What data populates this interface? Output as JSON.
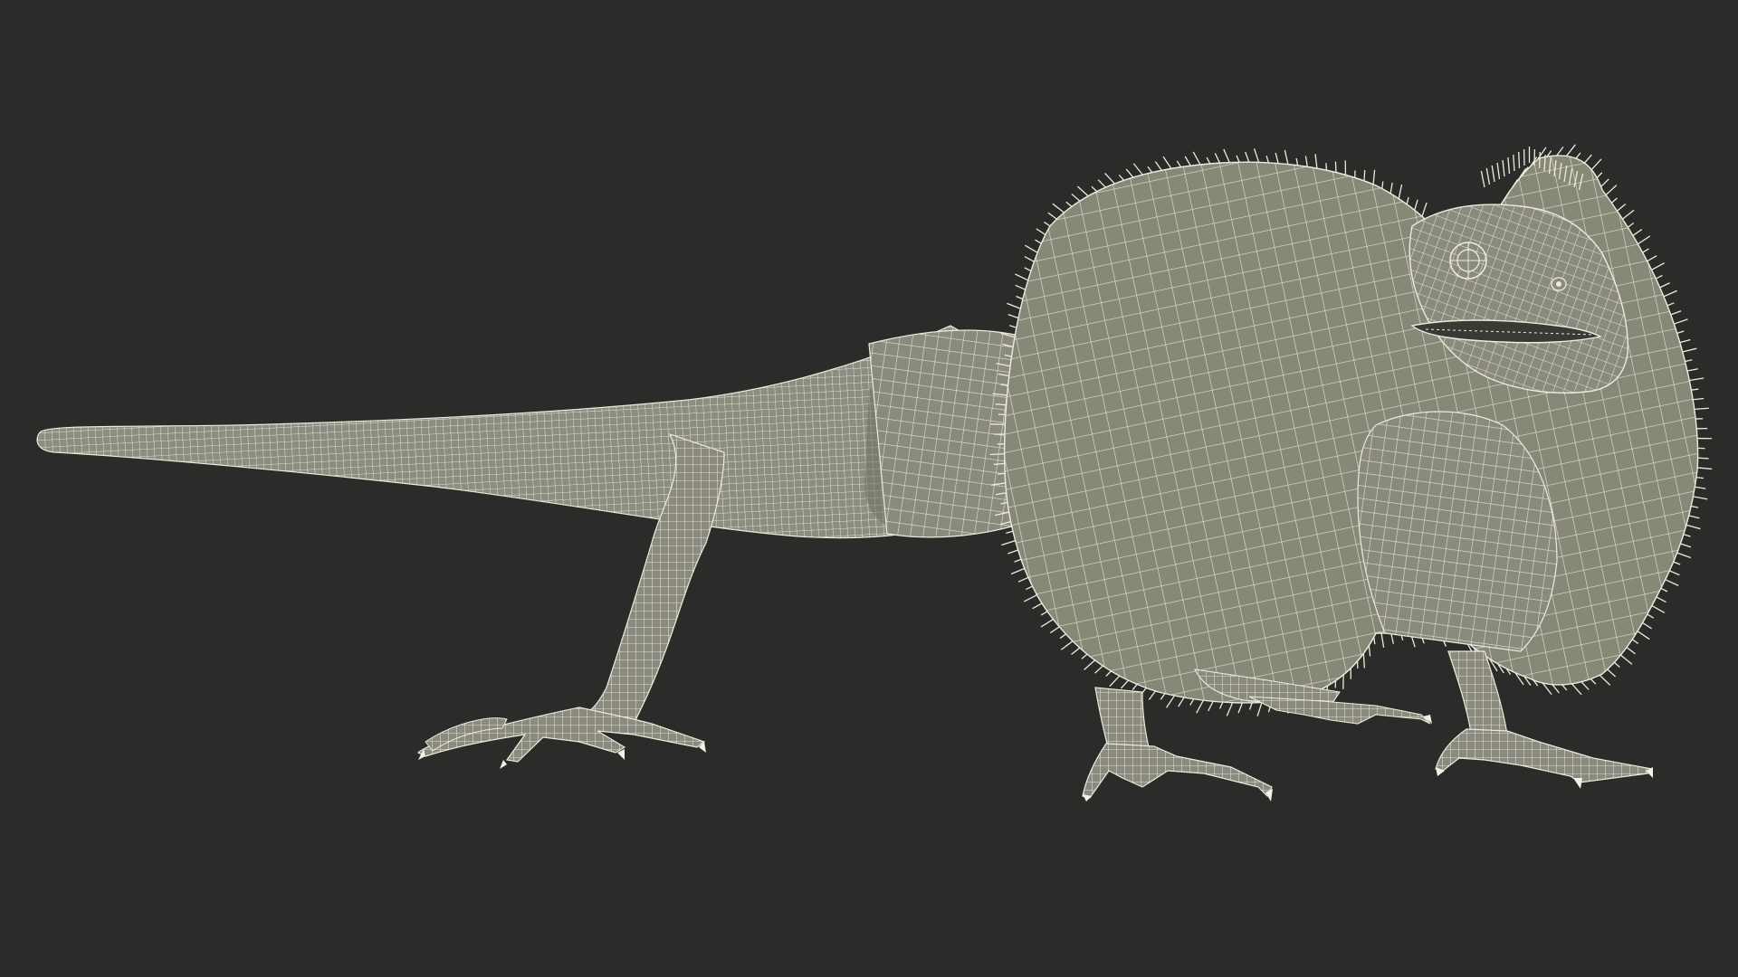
{
  "scene": {
    "subject": "frilled-lizard-wireframe",
    "colors": {
      "background": "#2b2b29",
      "surface": "#8a8b7e",
      "surface_shade": "#6e6f64",
      "wire": "#ecebdc",
      "mouth": "#3a3a34",
      "claw": "#f2f1e6"
    }
  }
}
